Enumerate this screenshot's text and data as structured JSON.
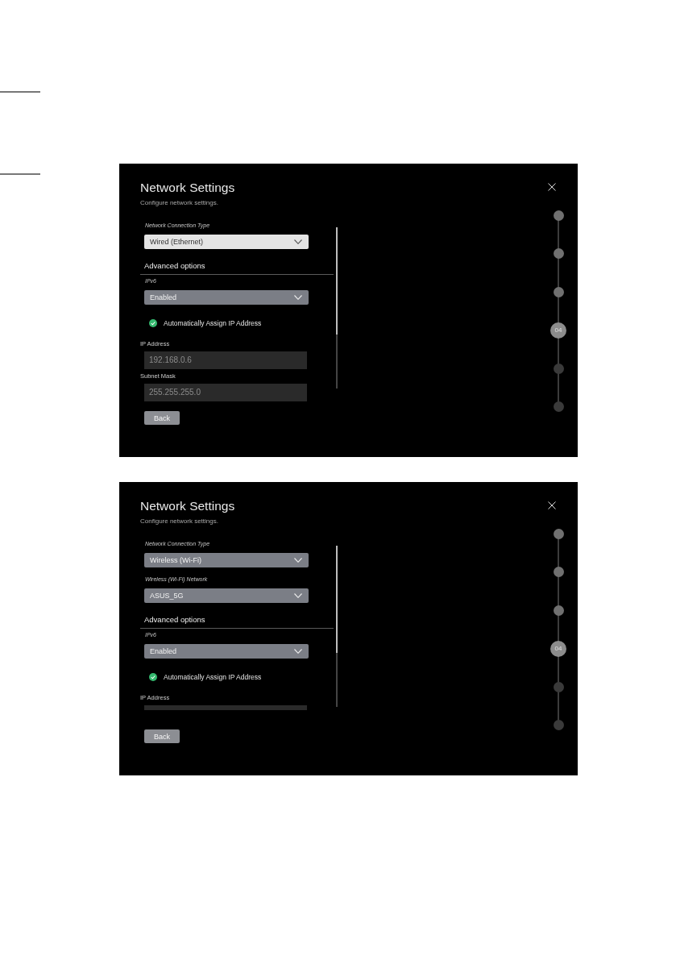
{
  "screens": [
    {
      "title": "Network Settings",
      "subtitle": "Configure network settings.",
      "items": [
        {
          "kind": "dropdown",
          "label": "Network Connection Type",
          "value": "Wired (Ethernet)",
          "focused": true
        },
        {
          "kind": "section",
          "title": "Advanced options"
        },
        {
          "kind": "dropdown",
          "label": "IPv6",
          "value": "Enabled",
          "focused": false
        },
        {
          "kind": "checkbox",
          "label": "Automatically Assign IP Address",
          "checked": true
        },
        {
          "kind": "text_field",
          "label": "IP Address",
          "value": "192.168.0.6",
          "disabled": true,
          "cut": false
        },
        {
          "kind": "text_field",
          "label": "Subnet Mask",
          "value": "255.255.255.0",
          "disabled": true,
          "cut": false
        }
      ],
      "back_button": "Back",
      "steps": [
        {
          "completed": true,
          "selected": false
        },
        {
          "completed": true,
          "selected": false
        },
        {
          "completed": true,
          "selected": false
        },
        {
          "completed": false,
          "selected": true,
          "number": "04"
        },
        {
          "completed": false,
          "selected": false
        },
        {
          "completed": false,
          "selected": false
        }
      ]
    },
    {
      "title": "Network Settings",
      "subtitle": "Configure network settings.",
      "items": [
        {
          "kind": "dropdown",
          "label": "Network Connection Type",
          "value": "Wireless (Wi-Fi)",
          "focused": false
        },
        {
          "kind": "dropdown",
          "label": "Wireless (Wi-Fi) Network",
          "value": "ASUS_5G",
          "focused": false
        },
        {
          "kind": "section",
          "title": "Advanced options"
        },
        {
          "kind": "dropdown",
          "label": "IPv6",
          "value": "Enabled",
          "focused": false
        },
        {
          "kind": "checkbox",
          "label": "Automatically Assign IP Address",
          "checked": true
        },
        {
          "kind": "text_field",
          "label": "IP Address",
          "disabled": true,
          "cut": true
        }
      ],
      "back_button": "Back",
      "steps": [
        {
          "completed": true,
          "selected": false
        },
        {
          "completed": true,
          "selected": false
        },
        {
          "completed": true,
          "selected": false
        },
        {
          "completed": false,
          "selected": true,
          "number": "04"
        },
        {
          "completed": false,
          "selected": false
        },
        {
          "completed": false,
          "selected": false
        }
      ]
    }
  ]
}
